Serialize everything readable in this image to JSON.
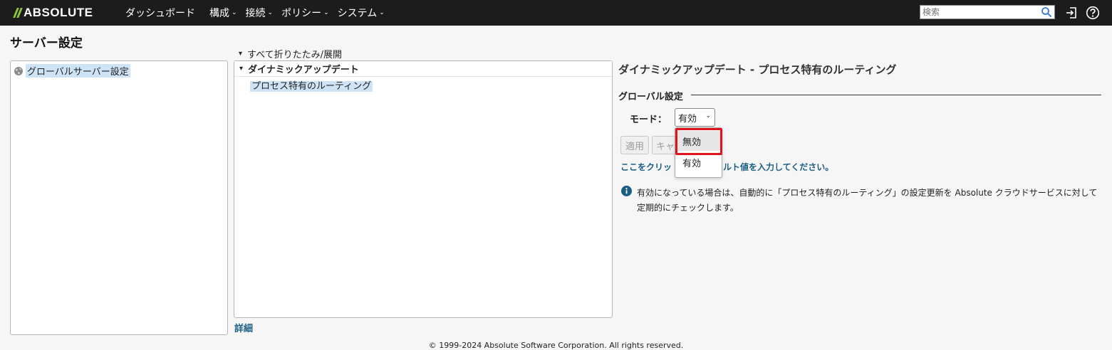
{
  "header": {
    "logo_text": "ABSOLUTE",
    "nav": [
      {
        "label": "ダッシュボード",
        "has_menu": false
      },
      {
        "label": "構成",
        "has_menu": true
      },
      {
        "label": "接続",
        "has_menu": true
      },
      {
        "label": "ポリシー",
        "has_menu": true
      },
      {
        "label": "システム",
        "has_menu": true
      }
    ],
    "search_placeholder": "検索",
    "icons": [
      "search-icon",
      "logout-icon",
      "help-icon"
    ]
  },
  "page": {
    "title": "サーバー設定"
  },
  "left_tree": {
    "items": [
      {
        "label": "グローバルサーバー設定",
        "icon": "globe-icon",
        "selected": true
      }
    ]
  },
  "middle": {
    "collapse_all": "すべて折りたたみ/展開",
    "group": "ダイナミックアップデート",
    "items": [
      {
        "label": "プロセス特有のルーティング",
        "selected": true
      }
    ],
    "details_link": "詳細"
  },
  "right": {
    "title": "ダイナミックアップデート - プロセス特有のルーティング",
    "section": "グローバル設定",
    "mode_label": "モード：",
    "mode_value": "有効",
    "apply": "適用",
    "cancel": "キャ",
    "default_link": "ここをクリッ　　　　　ォルト値を入力してください。",
    "info": "有効になっている場合は、自動的に「プロセス特有のルーティング」の設定更新を Absolute クラウドサービスに対して定期的にチェックします。"
  },
  "dropdown": {
    "options": [
      "無効",
      "有効"
    ],
    "highlighted": "無効"
  },
  "footer": "© 1999-2024 Absolute Software Corporation. All rights reserved.",
  "colors": {
    "topbar": "#1c1c1c",
    "logo_accent": "#8dc63f",
    "link": "#1a5e84",
    "selection": "#cfe3f7",
    "highlight_border": "#e0141e"
  }
}
